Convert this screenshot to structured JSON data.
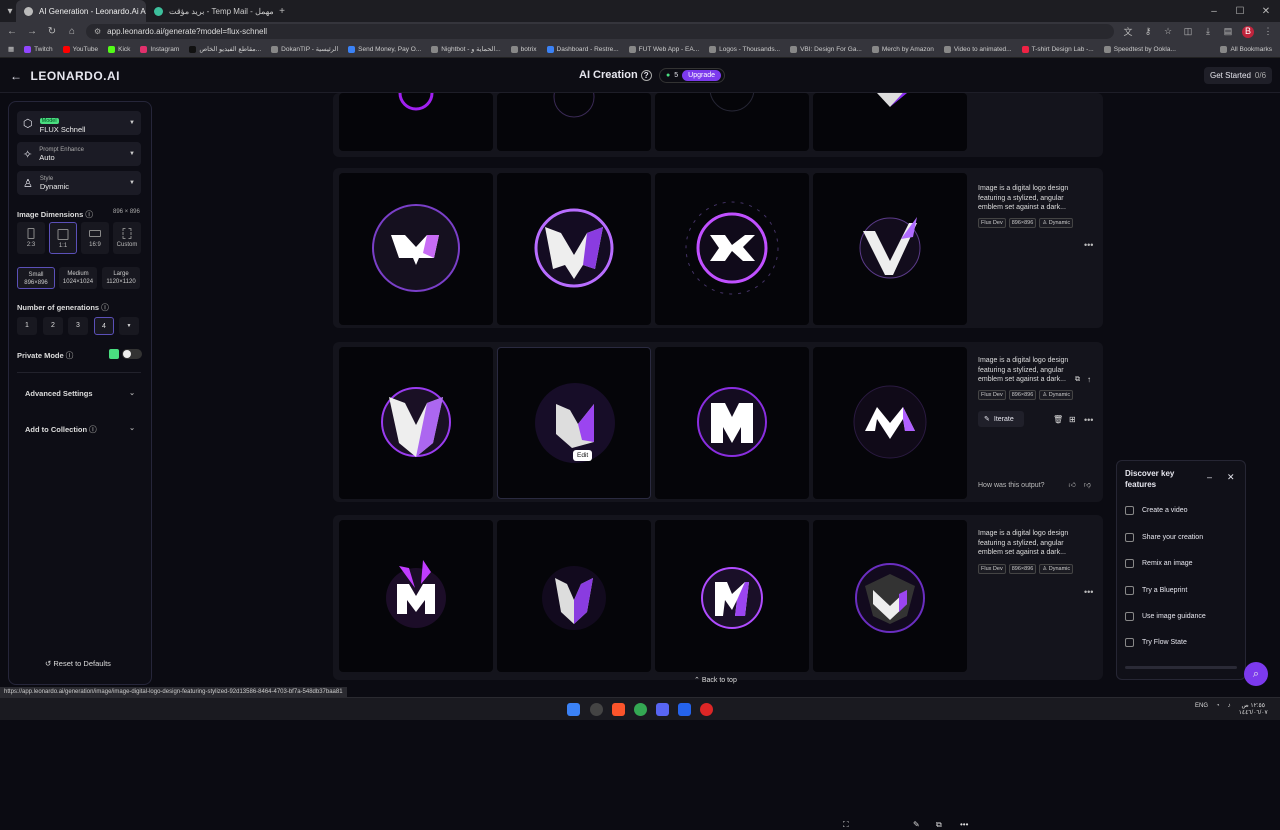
{
  "browser": {
    "tabs": [
      {
        "title": "AI Generation - Leonardo.Ai Ap",
        "favicon_color": "#bbbbbb"
      },
      {
        "title": "بريد مؤقت - Temp Mail - مهمل",
        "favicon_color": "#3dbf9c"
      }
    ],
    "url": "app.leonardo.ai/generate?model=flux-schnell",
    "bookmarks": [
      "Twitch",
      "YouTube",
      "Kick",
      "Instagram",
      "مقاطع الفيديو الخاص...",
      "DokanTIP - الرئيسية",
      "Send Money, Pay O...",
      "Nightbot - الحماية و...",
      "botrix",
      "Dashboard - Restre...",
      "FUT Web App - EA...",
      "Logos - Thousands...",
      "VBI: Design For Ga...",
      "Merch by Amazon",
      "Video to animated...",
      "T-shirt Design Lab -...",
      "Speedtest by Ookla...",
      "All Bookmarks"
    ],
    "status_url": "https://app.leonardo.ai/generation/image/image-digital-logo-design-featuring-stylized-92d13586-8464-4703-bf7a-548db37baa81"
  },
  "header": {
    "logo": "LEONARDO.AI",
    "title": "AI Creation",
    "credits": "5",
    "upgrade": "Upgrade",
    "get_started": "Get Started",
    "progress": "0/6"
  },
  "sidebar": {
    "model_badge": "Model",
    "model": "FLUX Schnell",
    "prompt_enhance_label": "Prompt Enhance",
    "prompt_enhance": "Auto",
    "style_label": "Style",
    "style": "Dynamic",
    "dimensions_label": "Image Dimensions",
    "dimensions_value": "896 × 896",
    "ratios": [
      "2:3",
      "1:1",
      "16:9",
      "Custom"
    ],
    "sizes": [
      {
        "name": "Small",
        "dim": "896×896"
      },
      {
        "name": "Medium",
        "dim": "1024×1024"
      },
      {
        "name": "Large",
        "dim": "1120×1120"
      }
    ],
    "generations_label": "Number of generations",
    "generations": [
      "1",
      "2",
      "3",
      "4"
    ],
    "private_label": "Private Mode",
    "advanced": "Advanced Settings",
    "collection": "Add to Collection",
    "reset": "Reset to Defaults"
  },
  "generations": [
    {
      "desc": "Image is a digital logo design featuring a stylized, angular emblem set against a dark...",
      "model": "Flux Dev",
      "dim": "896×896",
      "style": "Dynamic"
    },
    {
      "desc": "Image is a digital logo design featuring a stylized, angular emblem set against a dark...",
      "model": "Flux Dev",
      "dim": "896×896",
      "style": "Dynamic"
    },
    {
      "desc": "Image is a digital logo design featuring a stylized, angular emblem set against a dark...",
      "model": "Flux Dev",
      "dim": "896×896",
      "style": "Dynamic"
    }
  ],
  "iterate": "Iterate",
  "feedback": "How was this output?",
  "tooltip": "Edit",
  "back_to_top": "Back to top",
  "discover": {
    "title": "Discover key features",
    "items": [
      "Create a video",
      "Share your creation",
      "Remix an image",
      "Try a Blueprint",
      "Use image guidance",
      "Try Flow State"
    ]
  },
  "taskbar": {
    "lang": "ENG",
    "time": "١٢:٥٥ ص",
    "date": "١٤٤٦/٠٦/٠٧"
  }
}
